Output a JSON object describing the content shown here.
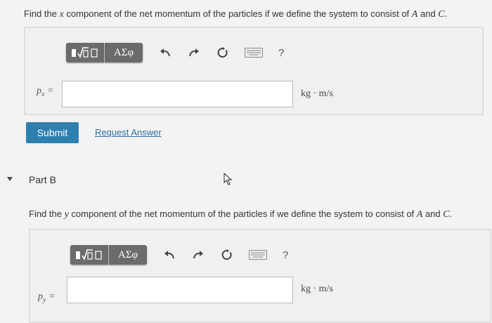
{
  "part_a": {
    "prompt": {
      "before": "Find the ",
      "var": "x",
      "middle": " component of the net momentum of the particles if we define the system to consist of ",
      "a": "A",
      "and": " and ",
      "c": "C",
      "end": "."
    },
    "toolbar": {
      "templates_label": "√□",
      "greek_label": "ΑΣφ",
      "help_label": "?"
    },
    "variable": {
      "base": "p",
      "sub": "x",
      "eq": " ="
    },
    "input_value": "",
    "unit": "kg · m/s",
    "submit_label": "Submit",
    "request_label": "Request Answer"
  },
  "part_b": {
    "title": "Part B",
    "prompt": {
      "before": "Find the ",
      "var": "y",
      "middle": " component of the net momentum of the particles if we define the system to consist of ",
      "a": "A",
      "and": " and ",
      "c": "C",
      "end": "."
    },
    "toolbar": {
      "templates_label": "√□",
      "greek_label": "ΑΣφ",
      "help_label": "?"
    },
    "variable": {
      "base": "p",
      "sub": "y",
      "eq": " ="
    },
    "input_value": "",
    "unit": "kg · m/s"
  },
  "colors": {
    "submit_bg": "#2f7fae",
    "link": "#2f6ea3",
    "toolbar_button": "#6b6b6b"
  }
}
